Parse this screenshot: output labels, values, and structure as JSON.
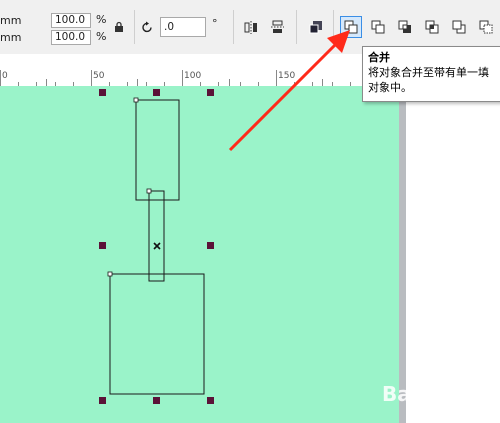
{
  "toolbar": {
    "width_unit": "mm",
    "height_unit": "mm",
    "scale_x": "100.0",
    "scale_y": "100.0",
    "percent": "%",
    "rotation": ".0",
    "degree": "°"
  },
  "ruler": {
    "labels": [
      "0",
      "50",
      "100",
      "150"
    ]
  },
  "tooltip": {
    "title": "合并",
    "line1": "将对象合并至带有单一填",
    "line2": "对象中。"
  },
  "colors": {
    "canvas": "#9af3c9",
    "handle": "#5b1238",
    "arrow": "#ff2a1a",
    "accent": "#3a8ee6"
  },
  "watermark": "Bai 经验"
}
